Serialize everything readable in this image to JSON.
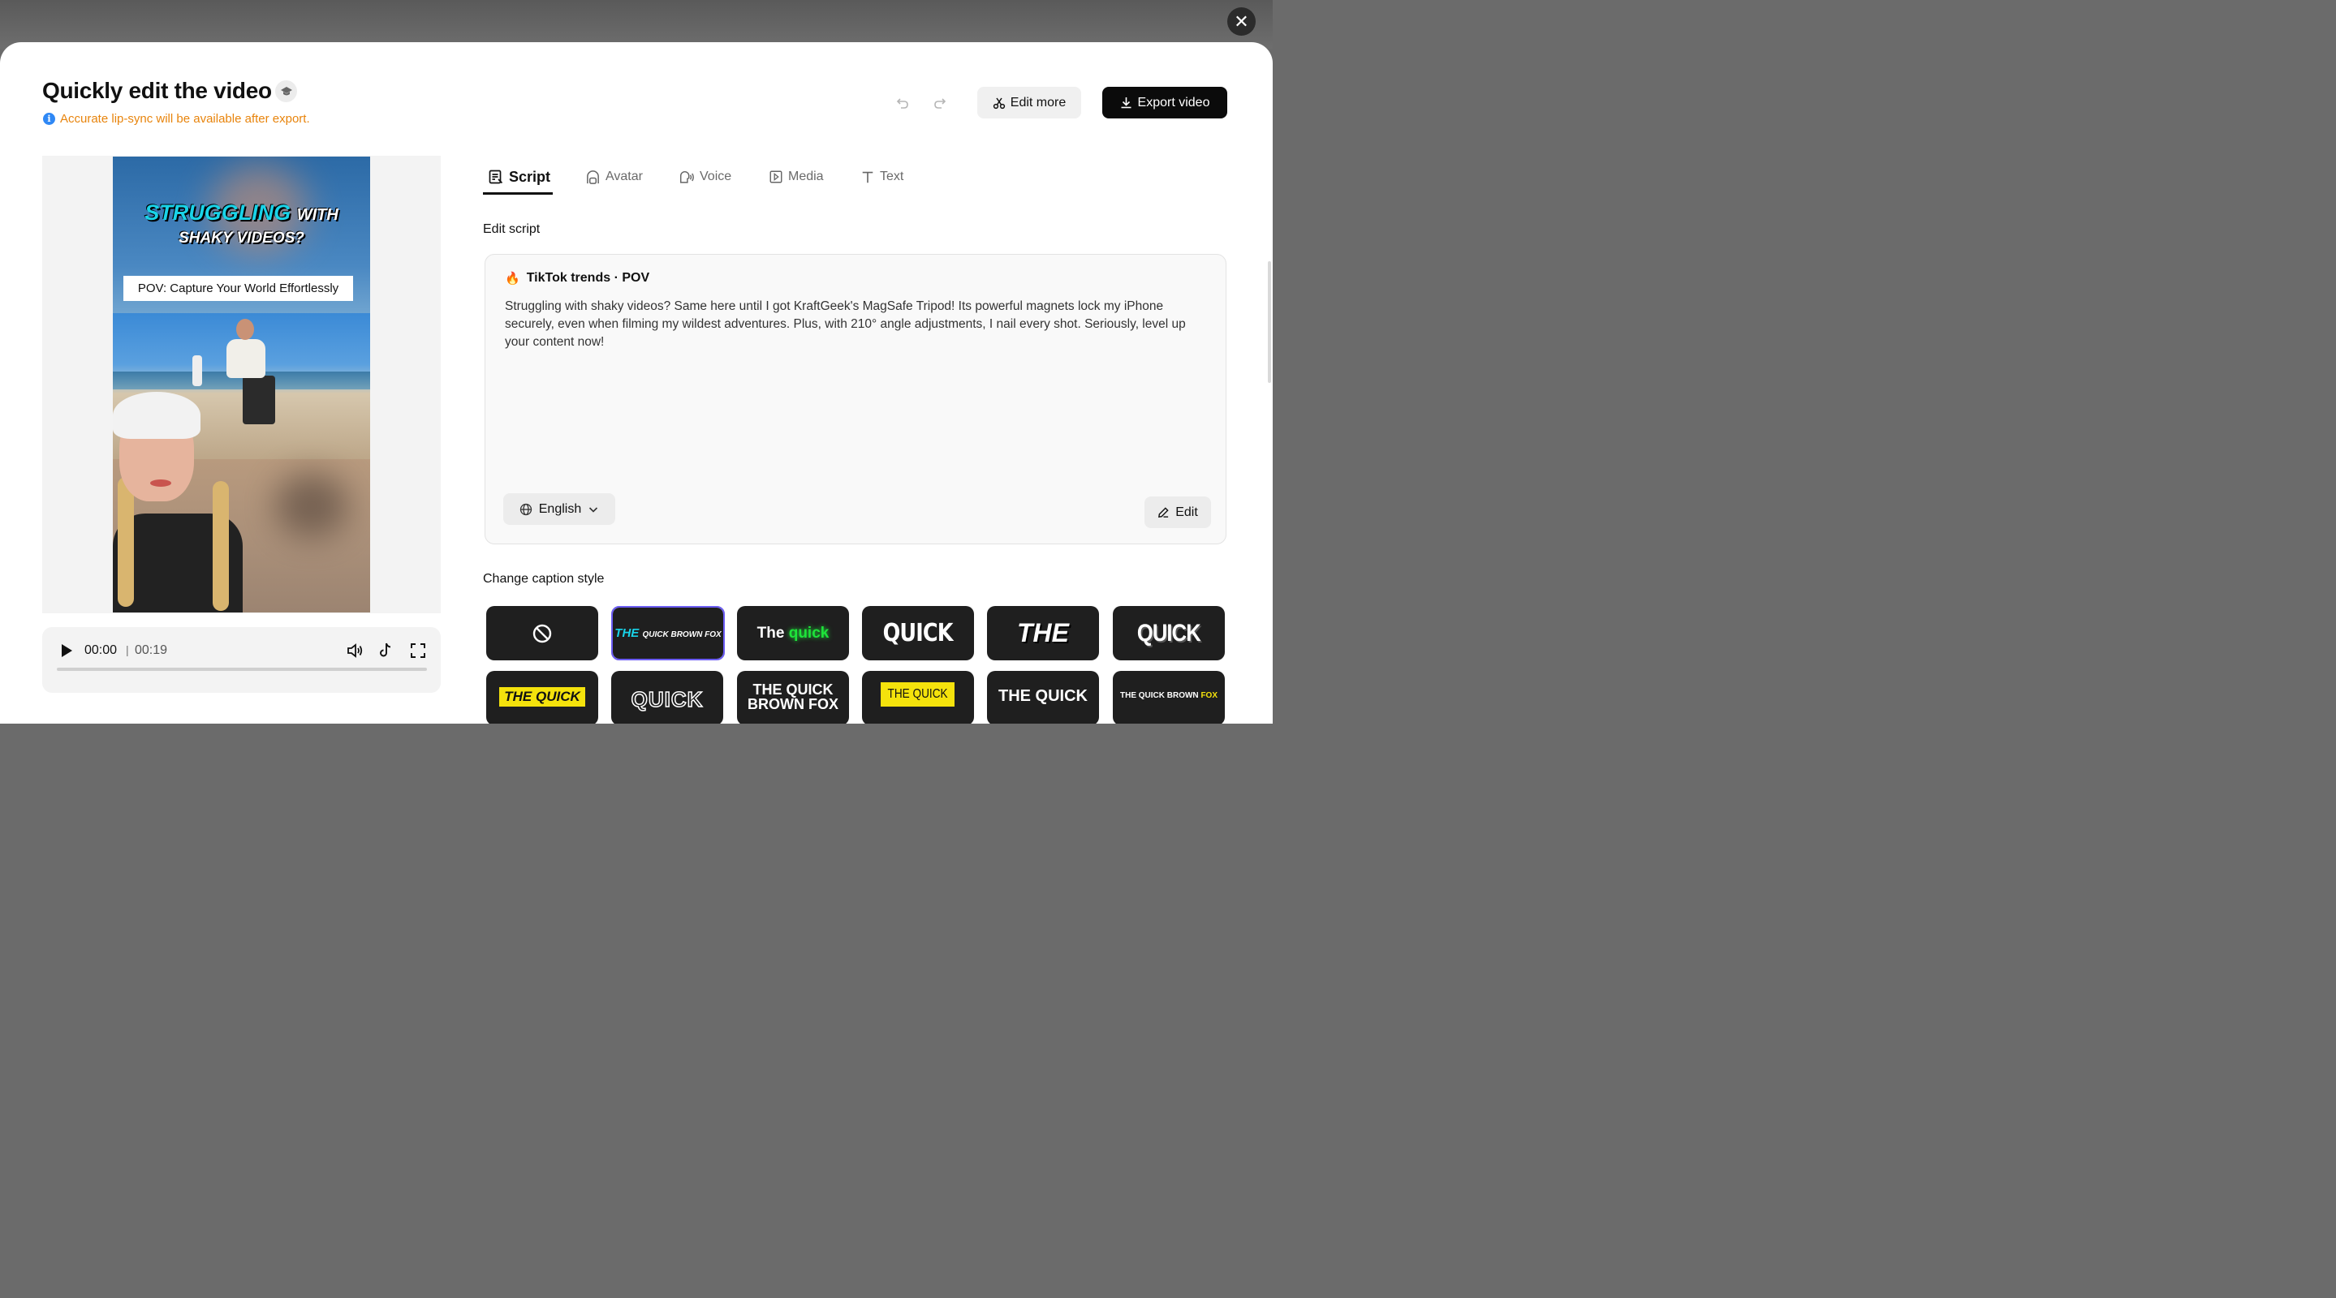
{
  "header": {
    "title": "Quickly edit the video",
    "notice": "Accurate lip-sync will be available after export.",
    "edit_more_label": "Edit more",
    "export_label": "Export video"
  },
  "video": {
    "caption_word1": "STRUGGLING",
    "caption_word2": "WITH",
    "caption_line2": "SHAKY VIDEOS?",
    "pov_text": "POV: Capture Your World Effortlessly"
  },
  "player": {
    "current_time": "00:00",
    "separator": "|",
    "total_time": "00:19",
    "progress": 0
  },
  "tabs": [
    {
      "label": "Script",
      "icon": "script-icon",
      "active": true
    },
    {
      "label": "Avatar",
      "icon": "avatar-icon"
    },
    {
      "label": "Voice",
      "icon": "voice-icon"
    },
    {
      "label": "Media",
      "icon": "media-icon"
    },
    {
      "label": "Text",
      "icon": "text-icon"
    }
  ],
  "script": {
    "section_title": "Edit script",
    "trend_label": "TikTok trends · POV",
    "body": "Struggling with shaky videos? Same here until I got KraftGeek's MagSafe Tripod! Its powerful magnets lock my iPhone securely, even when filming my wildest adventures. Plus, with 210° angle adjustments, I nail every shot. Seriously, level up your content now!",
    "language": "English",
    "edit_label": "Edit"
  },
  "captions": {
    "section_title": "Change caption style",
    "styles": [
      {
        "text": "",
        "icon": "no-style-icon"
      },
      {
        "text": "THE QUICK BROWN FOX",
        "selected": true
      },
      {
        "text": "The quick"
      },
      {
        "text": "QUICK"
      },
      {
        "text": "THE"
      },
      {
        "text": "QUICK"
      },
      {
        "text": "THE QUICK"
      },
      {
        "text": "QUICK"
      },
      {
        "text": "THE QUICK BROWN FOX"
      },
      {
        "text": "THE QUICK"
      },
      {
        "text": "THE QUICK"
      },
      {
        "text": "THE QUICK BROWN FOX"
      }
    ]
  },
  "colors": {
    "accent_orange": "#e8840c",
    "selected_outline": "#6b5cf3",
    "caption_cyan": "#19d3e8",
    "caption_green": "#1ee33a",
    "caption_yellow": "#f4e20c"
  }
}
